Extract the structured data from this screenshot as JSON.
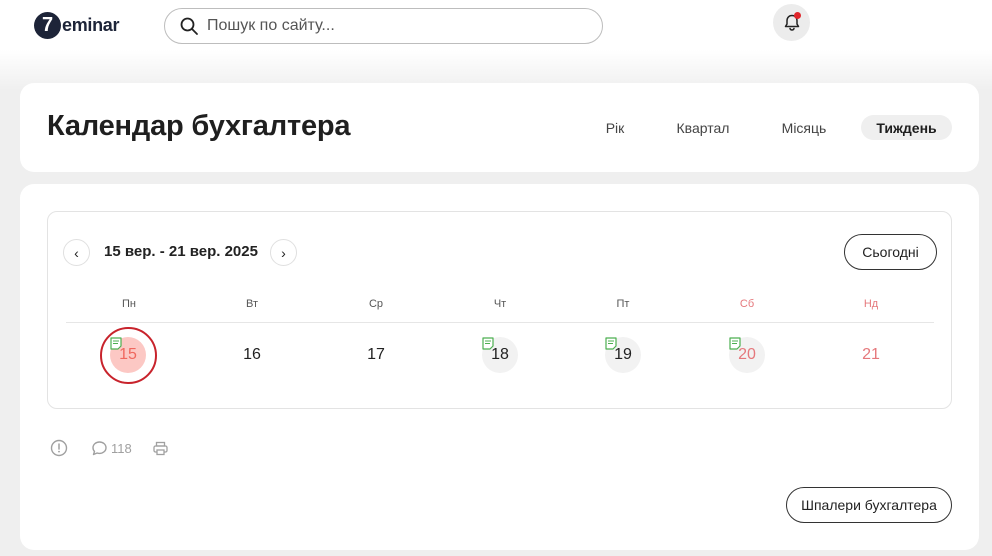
{
  "header": {
    "logo_digit": "7",
    "logo_text": "eminar",
    "search_placeholder": "Пошук по сайту..."
  },
  "title_card": {
    "title": "Календар бухгалтера",
    "tabs": [
      {
        "label": "Рік",
        "active": false
      },
      {
        "label": "Квартал",
        "active": false
      },
      {
        "label": "Місяць",
        "active": false
      },
      {
        "label": "Тиждень",
        "active": true
      }
    ]
  },
  "calendar": {
    "prev": "‹",
    "next": "›",
    "range": "15 вер. - 21 вер. 2025",
    "today_button": "Сьогодні",
    "weekdays": [
      "Пн",
      "Вт",
      "Ср",
      "Чт",
      "Пт",
      "Сб",
      "Нд"
    ],
    "days": [
      {
        "label": "15",
        "has_event": true,
        "today": true,
        "weekend": false
      },
      {
        "label": "16",
        "has_event": false,
        "today": false,
        "weekend": false
      },
      {
        "label": "17",
        "has_event": false,
        "today": false,
        "weekend": false
      },
      {
        "label": "18",
        "has_event": true,
        "today": false,
        "weekend": false
      },
      {
        "label": "19",
        "has_event": true,
        "today": false,
        "weekend": false
      },
      {
        "label": "20",
        "has_event": true,
        "today": false,
        "weekend": true
      },
      {
        "label": "21",
        "has_event": false,
        "today": false,
        "weekend": true
      }
    ]
  },
  "footer": {
    "comments_count": "118",
    "wallpaper_button": "Шпалери бухгалтера"
  },
  "colors": {
    "accent_red": "#e0262b",
    "weekend": "#e5787c",
    "today_bg": "#fcc8c4",
    "note_green": "#4caf50",
    "annotation_ring": "#c8232c"
  }
}
